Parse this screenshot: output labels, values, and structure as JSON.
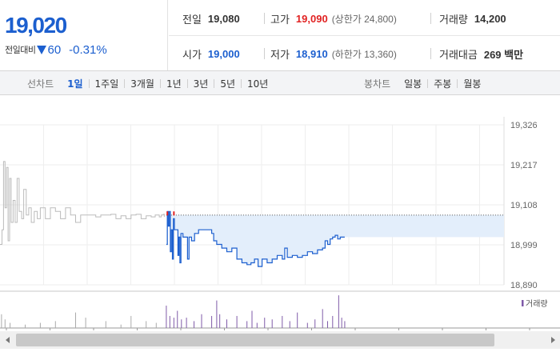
{
  "quote": {
    "price": "19,020",
    "change_label": "전일대비",
    "change": "60",
    "change_rate": "-0.31%",
    "stats": {
      "prev_close": {
        "label": "전일",
        "value": "19,080"
      },
      "high": {
        "label": "고가",
        "value": "19,090",
        "sub_label": "(상한가 24,800)"
      },
      "volume": {
        "label": "거래량",
        "value": "14,200"
      },
      "open": {
        "label": "시가",
        "value": "19,000"
      },
      "low": {
        "label": "저가",
        "value": "18,910",
        "sub_label": "(하한가 13,360)"
      },
      "trade_value": {
        "label": "거래대금",
        "value": "269 백만"
      }
    }
  },
  "tabs": {
    "line_label": "선차트",
    "line_tabs": [
      "1일",
      "1주일",
      "3개월",
      "1년",
      "3년",
      "5년",
      "10년"
    ],
    "line_active": 0,
    "candle_label": "봉차트",
    "candle_tabs": [
      "일봉",
      "주봉",
      "월봉"
    ]
  },
  "colors": {
    "up": "#e12222",
    "down": "#1c5fcf",
    "prior_line": "#bbbbbb",
    "area_fill": "#e3eefb",
    "volume_bar": "#7f5aa8"
  },
  "chart_data": {
    "type": "line",
    "y_ticks": [
      "19,326",
      "19,217",
      "19,108",
      "18,999",
      "18,890"
    ],
    "ylim": [
      18890,
      19326
    ],
    "grid": true,
    "reference_value": 19080,
    "prior_day_series": [
      [
        0.0,
        19000
      ],
      [
        0.004,
        19040
      ],
      [
        0.007,
        19226
      ],
      [
        0.01,
        19100
      ],
      [
        0.013,
        19210
      ],
      [
        0.016,
        19010
      ],
      [
        0.019,
        19180
      ],
      [
        0.022,
        19060
      ],
      [
        0.026,
        19120
      ],
      [
        0.03,
        19060
      ],
      [
        0.034,
        19180
      ],
      [
        0.038,
        19090
      ],
      [
        0.043,
        19070
      ],
      [
        0.047,
        19150
      ],
      [
        0.052,
        19080
      ],
      [
        0.057,
        19100
      ],
      [
        0.062,
        19060
      ],
      [
        0.068,
        19090
      ],
      [
        0.074,
        19070
      ],
      [
        0.08,
        19100
      ],
      [
        0.09,
        19070
      ],
      [
        0.1,
        19100
      ],
      [
        0.11,
        19090
      ],
      [
        0.12,
        19070
      ],
      [
        0.13,
        19100
      ],
      [
        0.14,
        19080
      ],
      [
        0.15,
        19060
      ],
      [
        0.16,
        19080
      ],
      [
        0.17,
        19080
      ],
      [
        0.18,
        19080
      ],
      [
        0.19,
        19075
      ],
      [
        0.2,
        19080
      ],
      [
        0.21,
        19080
      ],
      [
        0.22,
        19082
      ],
      [
        0.23,
        19070
      ],
      [
        0.24,
        19078
      ],
      [
        0.25,
        19070
      ],
      [
        0.26,
        19080
      ],
      [
        0.27,
        19082
      ],
      [
        0.28,
        19070
      ],
      [
        0.29,
        19078
      ],
      [
        0.3,
        19075
      ],
      [
        0.308,
        19080
      ],
      [
        0.316,
        19075
      ],
      [
        0.32,
        19080
      ],
      [
        0.324,
        19082
      ],
      [
        0.326,
        19075
      ]
    ],
    "today_series": [
      [
        0.33,
        19000
      ],
      [
        0.332,
        19090
      ],
      [
        0.334,
        19050
      ],
      [
        0.336,
        19090
      ],
      [
        0.338,
        18980
      ],
      [
        0.34,
        19040
      ],
      [
        0.342,
        18960
      ],
      [
        0.344,
        19070
      ],
      [
        0.346,
        19040
      ],
      [
        0.35,
        19040
      ],
      [
        0.353,
        18970
      ],
      [
        0.355,
        19020
      ],
      [
        0.357,
        18950
      ],
      [
        0.359,
        19030
      ],
      [
        0.363,
        19020
      ],
      [
        0.368,
        19020
      ],
      [
        0.372,
        18960
      ],
      [
        0.375,
        19020
      ],
      [
        0.38,
        19010
      ],
      [
        0.386,
        19030
      ],
      [
        0.394,
        19040
      ],
      [
        0.41,
        19040
      ],
      [
        0.42,
        19030
      ],
      [
        0.424,
        19010
      ],
      [
        0.43,
        19000
      ],
      [
        0.44,
        18990
      ],
      [
        0.45,
        18980
      ],
      [
        0.46,
        18990
      ],
      [
        0.47,
        18960
      ],
      [
        0.48,
        18950
      ],
      [
        0.49,
        18945
      ],
      [
        0.498,
        18950
      ],
      [
        0.505,
        18960
      ],
      [
        0.512,
        18940
      ],
      [
        0.52,
        18960
      ],
      [
        0.53,
        18950
      ],
      [
        0.54,
        18960
      ],
      [
        0.55,
        18970
      ],
      [
        0.56,
        18960
      ],
      [
        0.565,
        18990
      ],
      [
        0.57,
        18965
      ],
      [
        0.58,
        18970
      ],
      [
        0.59,
        18965
      ],
      [
        0.6,
        18970
      ],
      [
        0.61,
        18980
      ],
      [
        0.62,
        18975
      ],
      [
        0.63,
        18985
      ],
      [
        0.64,
        18990
      ],
      [
        0.645,
        19010
      ],
      [
        0.65,
        19000
      ],
      [
        0.655,
        19015
      ],
      [
        0.66,
        19020
      ],
      [
        0.665,
        19025
      ],
      [
        0.67,
        19015
      ],
      [
        0.675,
        19020
      ],
      [
        0.68,
        19020
      ],
      [
        0.684,
        19020
      ]
    ],
    "volume_legend": "거래량",
    "volume": [
      [
        0.003,
        0.4
      ],
      [
        0.01,
        0.25
      ],
      [
        0.02,
        0.15
      ],
      [
        0.05,
        0.1
      ],
      [
        0.08,
        0.15
      ],
      [
        0.11,
        0.2
      ],
      [
        0.15,
        0.45
      ],
      [
        0.17,
        0.3
      ],
      [
        0.21,
        0.2
      ],
      [
        0.24,
        0.1
      ],
      [
        0.26,
        0.35
      ],
      [
        0.29,
        0.2
      ],
      [
        0.31,
        0.15
      ],
      [
        0.33,
        0.65
      ],
      [
        0.337,
        0.35
      ],
      [
        0.345,
        0.3
      ],
      [
        0.352,
        0.5
      ],
      [
        0.36,
        0.25
      ],
      [
        0.37,
        0.3
      ],
      [
        0.385,
        0.2
      ],
      [
        0.4,
        0.4
      ],
      [
        0.42,
        0.35
      ],
      [
        0.43,
        0.8
      ],
      [
        0.436,
        0.4
      ],
      [
        0.45,
        0.25
      ],
      [
        0.47,
        0.35
      ],
      [
        0.49,
        0.2
      ],
      [
        0.5,
        0.5
      ],
      [
        0.51,
        0.15
      ],
      [
        0.525,
        0.3
      ],
      [
        0.54,
        0.25
      ],
      [
        0.56,
        0.35
      ],
      [
        0.575,
        0.2
      ],
      [
        0.59,
        0.45
      ],
      [
        0.61,
        0.15
      ],
      [
        0.625,
        0.25
      ],
      [
        0.64,
        0.55
      ],
      [
        0.65,
        0.2
      ],
      [
        0.66,
        0.35
      ],
      [
        0.672,
        0.95
      ],
      [
        0.678,
        0.3
      ],
      [
        0.684,
        0.2
      ]
    ],
    "markers": [
      {
        "x": 0.332,
        "label": "high"
      },
      {
        "x": 0.345,
        "label": "high"
      }
    ]
  }
}
